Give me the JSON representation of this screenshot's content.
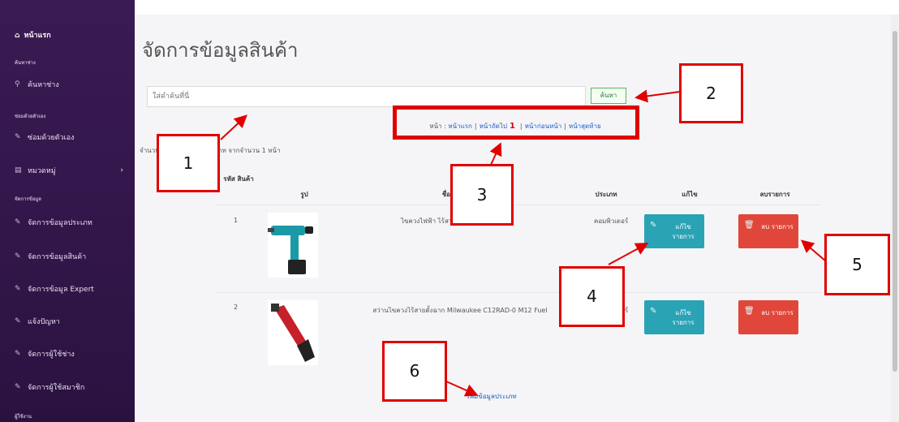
{
  "sidebar": {
    "home_label": "หน้าแรก",
    "section_search": "ค้นหาช่าง",
    "search_item": "ค้นหาช่าง",
    "section_self": "ซ่อมด้วยตัวเอง",
    "self_item": "ซ่อมด้วยตัวเอง",
    "category_item": "หมวดหมู่",
    "section_manage": "จัดการข้อมูล",
    "items": [
      {
        "label": "จัดการข้อมูลประเภท"
      },
      {
        "label": "จัดการข้อมูลสินค้า"
      },
      {
        "label": "จัดการข้อมูล Expert"
      },
      {
        "label": "แจ้งปัญหา"
      },
      {
        "label": "จัดการผู้ใช้ช่าง"
      },
      {
        "label": "จัดการผู้ใช้สมาชิก"
      }
    ],
    "section_bottom": "ผู้ใช้งาน"
  },
  "page": {
    "title": "จัดการข้อมูลสินค้า",
    "search_placeholder": "ใส่คำค้นที่นี่",
    "search_button": "ค้นหา",
    "pager": {
      "prefix": "หน้า :",
      "first": "หน้าแรก",
      "next": "หน้าถัดไป",
      "current": "1",
      "prev": "หน้าก่อนหน้า",
      "last": "หน้าสุดท้าย"
    },
    "summary": "จำนวนสินค้าทั้งหมด 3 ประเภท จากจำนวน 1 หน้า",
    "columns": {
      "id": "รหัส สินค้า",
      "image": "รูป",
      "name": "ชื่อ",
      "type": "ประเภท",
      "edit": "แก้ไข",
      "delete": "ลบรายการ"
    },
    "rows": [
      {
        "id": "1",
        "name": "ไขควงไฟฟ้า ไร้สาย Makita DFS250Z",
        "type": "คอมพิวเตอร์",
        "edit": "แก้ไข รายการ",
        "delete": "ลบ รายการ"
      },
      {
        "id": "2",
        "name": "สว่านไขควงไร้สายตั้งฉาก Milwaukee C12RAD-0 M12 Fuel",
        "type": "คอมพิวเตอร์",
        "edit": "แก้ไข รายการ",
        "delete": "ลบ รายการ"
      }
    ],
    "add_link": "เพิ่มข้อมูลประเภท"
  },
  "callouts": [
    "1",
    "2",
    "3",
    "4",
    "5",
    "6"
  ],
  "colors": {
    "sidebar": "#3a1a52",
    "edit": "#2aa3b5",
    "delete": "#e0473a",
    "callout": "#e00000"
  }
}
